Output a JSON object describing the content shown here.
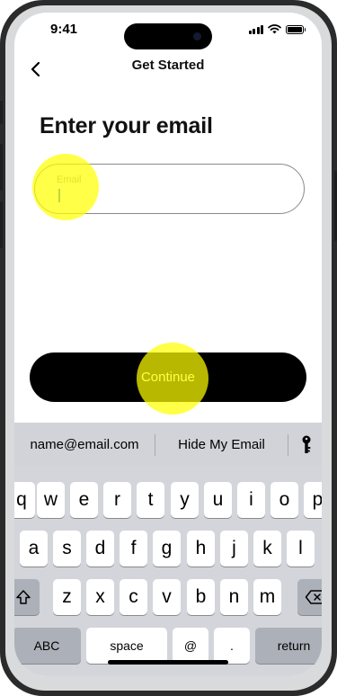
{
  "status_bar": {
    "time": "9:41"
  },
  "header": {
    "title": "Get Started",
    "back_icon": "chevron-left-icon"
  },
  "main": {
    "title": "Enter your email",
    "email_field": {
      "label": "Email",
      "value": ""
    },
    "continue_label": "Continue"
  },
  "keyboard": {
    "suggestions": [
      "name@email.com",
      "Hide My Email"
    ],
    "suggestion_icon": "key-icon",
    "row1": [
      "q",
      "w",
      "e",
      "r",
      "t",
      "y",
      "u",
      "i",
      "o",
      "p"
    ],
    "row2": [
      "a",
      "s",
      "d",
      "f",
      "g",
      "h",
      "j",
      "k",
      "l"
    ],
    "row3": [
      "z",
      "x",
      "c",
      "v",
      "b",
      "n",
      "m"
    ],
    "shift_icon": "shift-icon",
    "delete_icon": "delete-icon",
    "bottom": {
      "abc": "ABC",
      "space": "space",
      "at": "@",
      "dot": ".",
      "return": "return"
    }
  },
  "colors": {
    "button_bg": "#000000",
    "tap_highlight": "#ffff00",
    "keyboard_bg": "#d3d5db"
  }
}
